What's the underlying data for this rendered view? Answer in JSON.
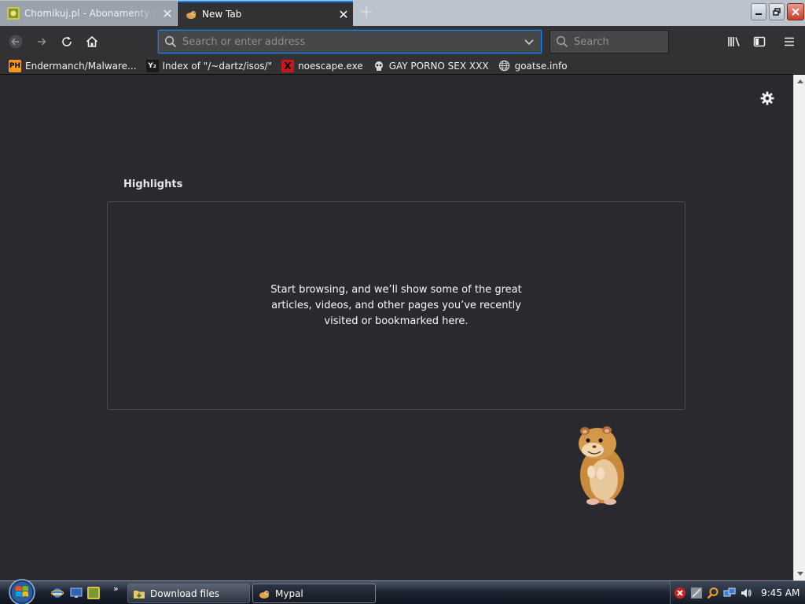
{
  "tabs": [
    {
      "title": "Chomikuj.pl - Abonamenty iD",
      "icon": "chomikuj-icon",
      "active": false
    },
    {
      "title": "New Tab",
      "icon": "hamster-favicon",
      "active": true
    }
  ],
  "toolbar": {
    "url_placeholder": "Search or enter address",
    "url_value": "",
    "search_placeholder": "Search"
  },
  "bookmarks": [
    {
      "label": "Endermanch/Malware...",
      "icon": "ph-icon",
      "icon_text": "PH"
    },
    {
      "label": "Index of \"/~dartz/isos/\"",
      "icon": "yp-icon",
      "icon_text": "Y₂"
    },
    {
      "label": "noescape.exe",
      "icon": "x-icon",
      "icon_text": "X"
    },
    {
      "label": "GAY PORNO SEX XXX",
      "icon": "skull-icon",
      "icon_text": ""
    },
    {
      "label": "goatse.info",
      "icon": "globe-icon",
      "icon_text": ""
    }
  ],
  "newtab": {
    "highlights_title": "Highlights",
    "empty_message": "Start browsing, and we’ll show some of the great articles, videos, and other pages you’ve recently visited or bookmarked here."
  },
  "taskbar": {
    "buttons": [
      {
        "label": "Download files",
        "icon": "folder-download-icon"
      },
      {
        "label": "Mypal",
        "icon": "hamster-favicon",
        "active": true
      }
    ],
    "clock": "9:45 AM"
  },
  "colors": {
    "accent": "#0a84ff",
    "page_bg": "#2a2a2e",
    "toolbar_bg": "#323234",
    "tabstrip_bg": "#bcc3cc"
  }
}
